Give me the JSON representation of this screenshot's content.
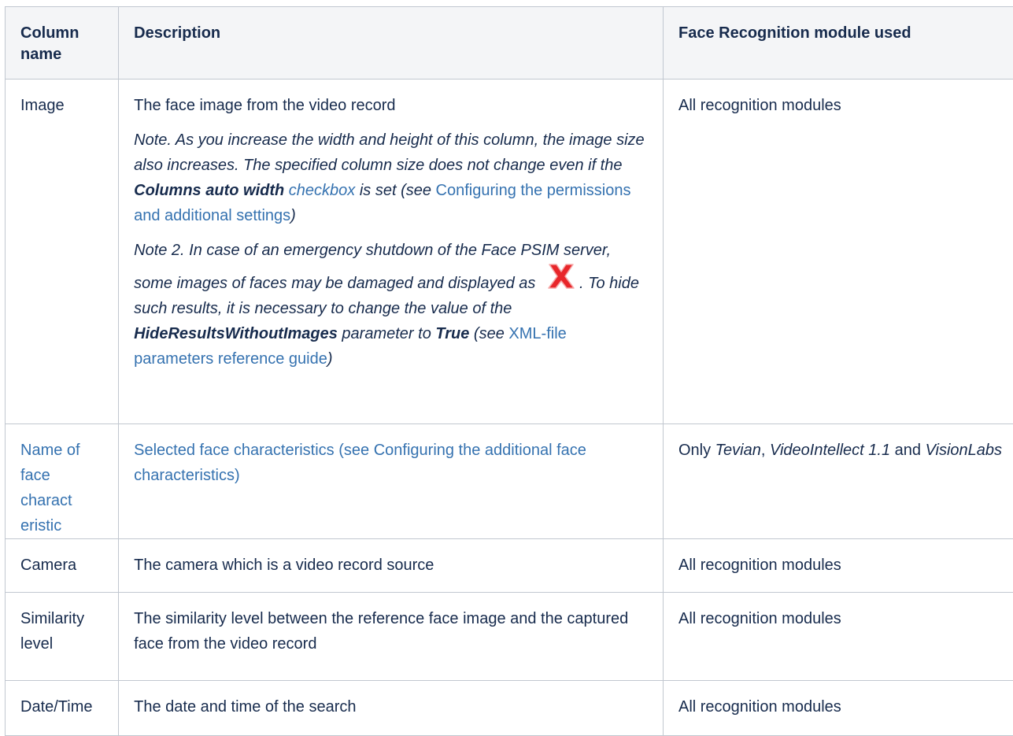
{
  "table": {
    "headers": [
      "Column name",
      "Description",
      "Face Recognition module used"
    ],
    "rows": [
      {
        "name": "Image",
        "description": {
          "main": "The face image from the video record",
          "note1": {
            "text1": "Note. As you increase the width and height of this column, the image size also increases. The specified column size does not change even if the ",
            "bold": "Columns auto width",
            "text2": " ",
            "link_checkbox": "checkbox",
            "text3": " is set (see ",
            "link": "Configuring the permissions and additional settings",
            "text4": ")"
          },
          "note2": {
            "text1": "Note 2. In case of an emergency shutdown of the Face PSIM server, some images of faces may be damaged and displayed as ",
            "icon": "broken-image-red-x-icon",
            "text2": ". To hide such results, it is necessary to change the value of the ",
            "bold1": "HideResultsWithoutImages",
            "text3": " parameter to ",
            "bold2": "True",
            "text4": " (see ",
            "link": "XML-file parameters reference guide",
            "text5": ")"
          }
        },
        "module": "All recognition modules"
      },
      {
        "name": "Name of face charact eristic",
        "description": {
          "text1": "Selected face characteristics (see ",
          "link": "Configuring the additional face characteristics",
          "text2": ")"
        },
        "module": {
          "prefix": "Only ",
          "m1": "Tevian",
          "sep1": ", ",
          "m2": "VideoIntellect 1.1",
          "sep2": " and ",
          "m3": "VisionLabs"
        }
      },
      {
        "name": "Camera",
        "description": "The camera which is a video record source",
        "module": "All recognition modules"
      },
      {
        "name": "Similarity level",
        "description": "The similarity level between the reference face image and the captured face from the video record",
        "module": "All recognition modules"
      },
      {
        "name": "Date/Time",
        "description": "The date and time of the search",
        "module": "All recognition modules"
      }
    ]
  },
  "colors": {
    "header_bg": "#f4f5f7",
    "border": "#c1c7d0",
    "link": "#3572b0",
    "text": "#172b4d",
    "icon_red": "#e8262a"
  }
}
